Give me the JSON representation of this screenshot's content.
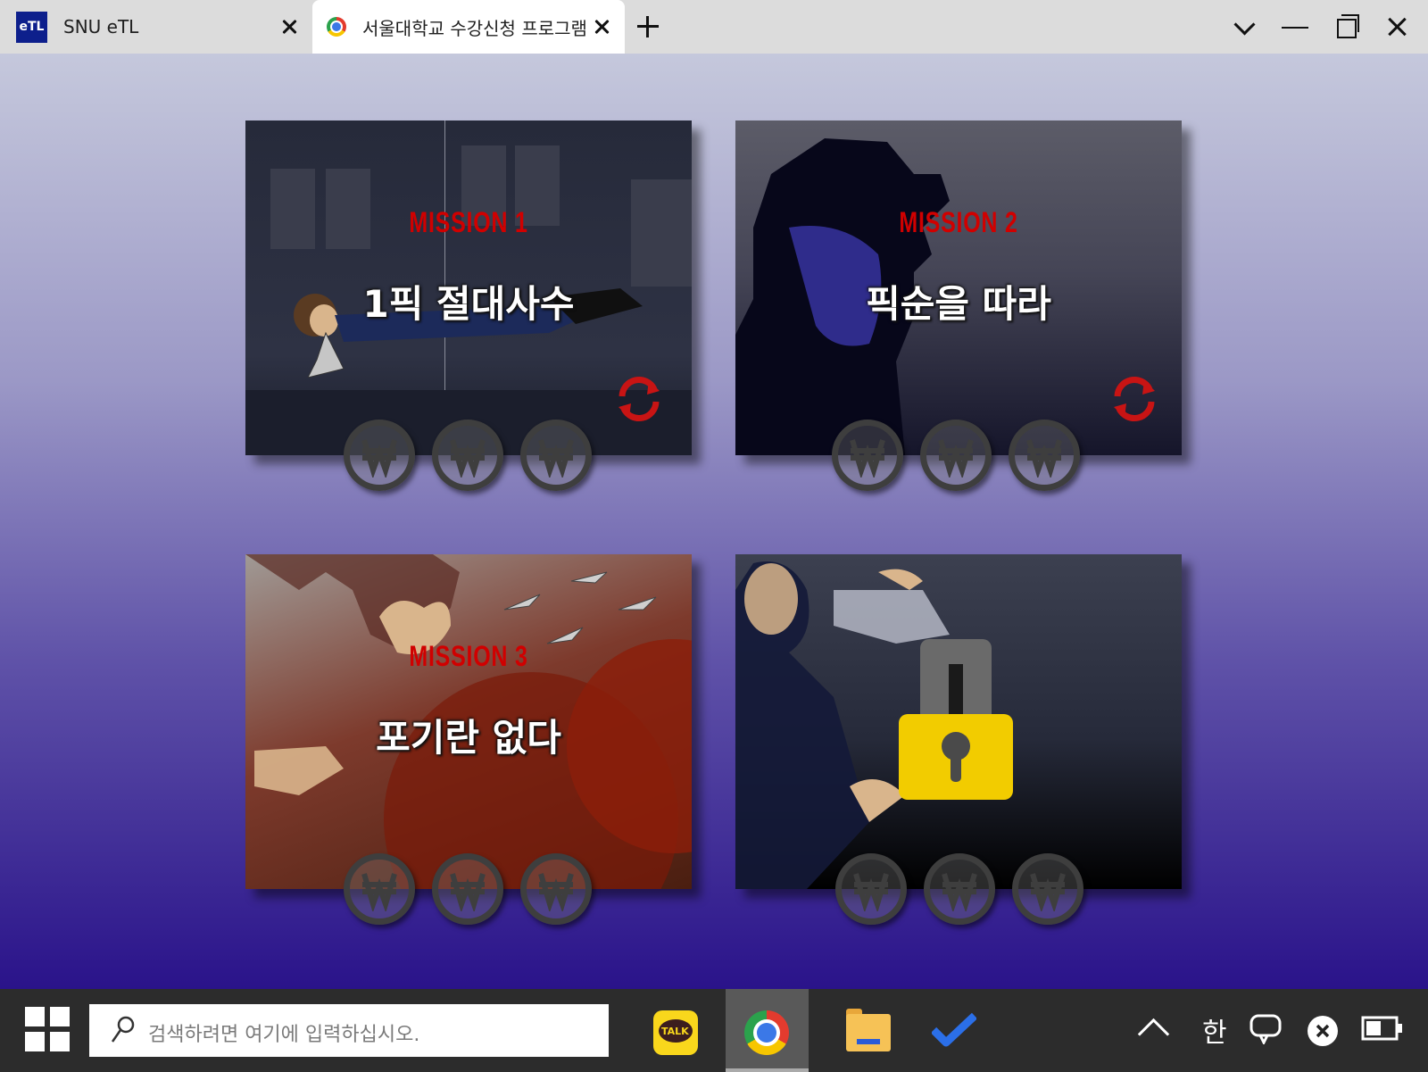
{
  "browser": {
    "tabs": [
      {
        "title": "SNU eTL",
        "icon": "etl-logo-icon",
        "logo_text": "eTL",
        "active": false
      },
      {
        "title": "서울대학교 수강신청 프로그램",
        "icon": "chrome-icon",
        "active": true
      }
    ]
  },
  "missions": [
    {
      "label": "MISSION 1",
      "title": "1픽 절대사수",
      "locked": false,
      "coins": 3,
      "has_refresh": true
    },
    {
      "label": "MISSION 2",
      "title": "픽순을 따라",
      "locked": false,
      "coins": 3,
      "has_refresh": true
    },
    {
      "label": "MISSION 3",
      "title": "포기란 없다",
      "locked": false,
      "coins": 3,
      "has_refresh": false
    },
    {
      "label": "",
      "title": "",
      "locked": true,
      "coins": 3,
      "has_refresh": false
    }
  ],
  "colors": {
    "mission_label": "#d00000",
    "lock_body": "#f2cc00",
    "coin": "#3e3e3e",
    "refresh": "#c81414"
  },
  "taskbar": {
    "search_placeholder": "검색하려면 여기에 입력하십시오.",
    "apps": [
      "kakaotalk-icon",
      "chrome-icon",
      "file-explorer-icon",
      "todo-icon"
    ],
    "kakao_text": "TALK",
    "ime": "한"
  }
}
